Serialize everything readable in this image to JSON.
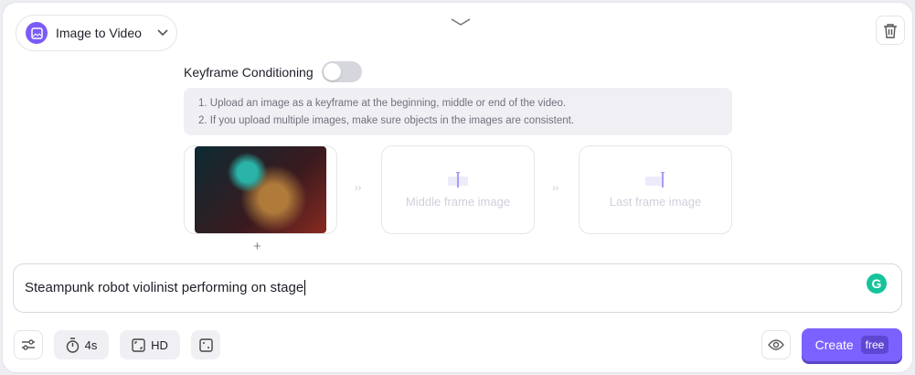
{
  "mode": {
    "label": "Image to Video"
  },
  "keyframe": {
    "label": "Keyframe Conditioning",
    "enabled": false
  },
  "tips": [
    "1.  Upload an image as a keyframe at the beginning, middle or end of the video.",
    "2.  If you upload multiple images, make sure objects in the images are consistent."
  ],
  "frames": {
    "middle": "Middle frame image",
    "last": "Last frame image",
    "arrow": "››",
    "add": "+"
  },
  "prompt": {
    "value": "Steampunk robot violinist performing on stage"
  },
  "toolbar": {
    "duration": "4s",
    "quality": "HD",
    "create": "Create",
    "free": "free",
    "grammarly": "G"
  }
}
